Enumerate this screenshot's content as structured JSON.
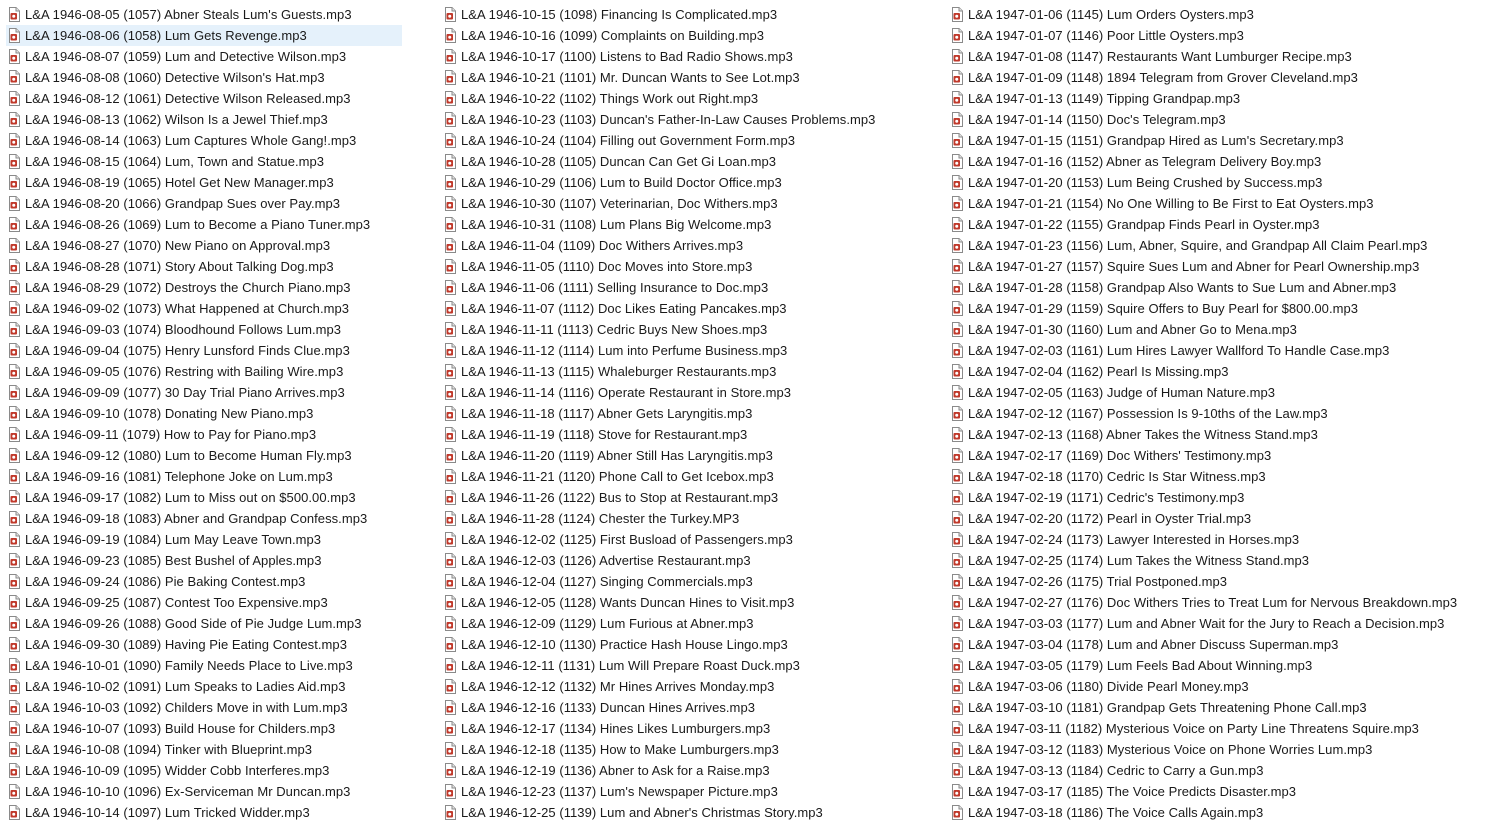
{
  "icon": "audio-file-icon",
  "selected_file": "L&A 1946-08-06 (1058) Lum Gets Revenge.mp3",
  "columns": [
    {
      "files": [
        "L&A 1946-08-05 (1057) Abner Steals Lum's Guests.mp3",
        "L&A 1946-08-06 (1058) Lum Gets Revenge.mp3",
        "L&A 1946-08-07 (1059) Lum and Detective Wilson.mp3",
        "L&A 1946-08-08 (1060) Detective Wilson's Hat.mp3",
        "L&A 1946-08-12 (1061) Detective Wilson Released.mp3",
        "L&A 1946-08-13 (1062) Wilson Is a Jewel Thief.mp3",
        "L&A 1946-08-14 (1063) Lum Captures Whole Gang!.mp3",
        "L&A 1946-08-15 (1064) Lum, Town and Statue.mp3",
        "L&A 1946-08-19 (1065) Hotel Get New Manager.mp3",
        "L&A 1946-08-20 (1066) Grandpap Sues over Pay.mp3",
        "L&A 1946-08-26 (1069) Lum to Become a Piano Tuner.mp3",
        "L&A 1946-08-27 (1070) New Piano on Approval.mp3",
        "L&A 1946-08-28 (1071) Story About Talking Dog.mp3",
        "L&A 1946-08-29 (1072) Destroys the Church Piano.mp3",
        "L&A 1946-09-02 (1073) What Happened at Church.mp3",
        "L&A 1946-09-03 (1074) Bloodhound Follows Lum.mp3",
        "L&A 1946-09-04 (1075) Henry Lunsford Finds Clue.mp3",
        "L&A 1946-09-05 (1076) Restring with Bailing Wire.mp3",
        "L&A 1946-09-09 (1077) 30 Day Trial Piano Arrives.mp3",
        "L&A 1946-09-10 (1078) Donating New Piano.mp3",
        "L&A 1946-09-11 (1079) How to Pay for Piano.mp3",
        "L&A 1946-09-12 (1080) Lum to Become Human Fly.mp3",
        "L&A 1946-09-16 (1081) Telephone Joke on Lum.mp3",
        "L&A 1946-09-17 (1082) Lum to Miss out on $500.00.mp3",
        "L&A 1946-09-18 (1083) Abner and Grandpap Confess.mp3",
        "L&A 1946-09-19 (1084) Lum May Leave Town.mp3",
        "L&A 1946-09-23 (1085) Best Bushel of Apples.mp3",
        "L&A 1946-09-24 (1086) Pie Baking Contest.mp3",
        "L&A 1946-09-25 (1087) Contest Too Expensive.mp3",
        "L&A 1946-09-26 (1088) Good Side of Pie Judge Lum.mp3",
        "L&A 1946-09-30 (1089) Having Pie Eating Contest.mp3",
        "L&A 1946-10-01 (1090) Family Needs Place to Live.mp3",
        "L&A 1946-10-02 (1091) Lum Speaks to Ladies Aid.mp3",
        "L&A 1946-10-03 (1092) Childers Move in with Lum.mp3",
        "L&A 1946-10-07 (1093) Build House for Childers.mp3",
        "L&A 1946-10-08 (1094) Tinker with Blueprint.mp3",
        "L&A 1946-10-09 (1095) Widder Cobb Interferes.mp3",
        "L&A 1946-10-10 (1096) Ex-Serviceman Mr Duncan.mp3",
        "L&A 1946-10-14 (1097) Lum Tricked Widder.mp3"
      ]
    },
    {
      "files": [
        "L&A 1946-10-15 (1098) Financing Is Complicated.mp3",
        "L&A 1946-10-16 (1099) Complaints on Building.mp3",
        "L&A 1946-10-17 (1100) Listens to Bad Radio Shows.mp3",
        "L&A 1946-10-21 (1101) Mr. Duncan Wants to See Lot.mp3",
        "L&A 1946-10-22 (1102) Things Work out Right.mp3",
        "L&A 1946-10-23 (1103) Duncan's Father-In-Law Causes Problems.mp3",
        "L&A 1946-10-24 (1104) Filling out Government Form.mp3",
        "L&A 1946-10-28 (1105) Duncan Can Get Gi Loan.mp3",
        "L&A 1946-10-29 (1106) Lum to Build Doctor Office.mp3",
        "L&A 1946-10-30 (1107) Veterinarian, Doc Withers.mp3",
        "L&A 1946-10-31 (1108) Lum Plans Big Welcome.mp3",
        "L&A 1946-11-04 (1109) Doc Withers Arrives.mp3",
        "L&A 1946-11-05 (1110) Doc Moves into Store.mp3",
        "L&A 1946-11-06 (1111) Selling Insurance to Doc.mp3",
        "L&A 1946-11-07 (1112) Doc Likes Eating Pancakes.mp3",
        "L&A 1946-11-11 (1113) Cedric Buys New Shoes.mp3",
        "L&A 1946-11-12 (1114) Lum into Perfume Business.mp3",
        "L&A 1946-11-13 (1115) Whaleburger Restaurants.mp3",
        "L&A 1946-11-14 (1116) Operate Restaurant in Store.mp3",
        "L&A 1946-11-18 (1117) Abner Gets Laryngitis.mp3",
        "L&A 1946-11-19 (1118) Stove for Restaurant.mp3",
        "L&A 1946-11-20 (1119) Abner Still Has Laryngitis.mp3",
        "L&A 1946-11-21 (1120) Phone Call to Get Icebox.mp3",
        "L&A 1946-11-26 (1122) Bus to Stop at Restaurant.mp3",
        "L&A 1946-11-28 (1124) Chester the Turkey.MP3",
        "L&A 1946-12-02 (1125) First Busload of Passengers.mp3",
        "L&A 1946-12-03 (1126) Advertise Restaurant.mp3",
        "L&A 1946-12-04 (1127) Singing Commercials.mp3",
        "L&A 1946-12-05 (1128) Wants Duncan Hines to Visit.mp3",
        "L&A 1946-12-09 (1129) Lum Furious at Abner.mp3",
        "L&A 1946-12-10 (1130) Practice Hash House Lingo.mp3",
        "L&A 1946-12-11 (1131) Lum Will Prepare Roast Duck.mp3",
        "L&A 1946-12-12 (1132) Mr Hines Arrives Monday.mp3",
        "L&A 1946-12-16 (1133) Duncan Hines Arrives.mp3",
        "L&A 1946-12-17 (1134) Hines Likes Lumburgers.mp3",
        "L&A 1946-12-18 (1135) How to Make Lumburgers.mp3",
        "L&A 1946-12-19 (1136) Abner to Ask for a Raise.mp3",
        "L&A 1946-12-23 (1137) Lum's Newspaper Picture.mp3",
        "L&A 1946-12-25 (1139) Lum and Abner's Christmas Story.mp3"
      ]
    },
    {
      "files": [
        "L&A 1947-01-06 (1145) Lum Orders Oysters.mp3",
        "L&A 1947-01-07 (1146) Poor Little Oysters.mp3",
        "L&A 1947-01-08 (1147) Restaurants Want Lumburger Recipe.mp3",
        "L&A 1947-01-09 (1148) 1894 Telegram from Grover Cleveland.mp3",
        "L&A 1947-01-13 (1149) Tipping Grandpap.mp3",
        "L&A 1947-01-14 (1150) Doc's Telegram.mp3",
        "L&A 1947-01-15 (1151) Grandpap Hired as Lum's Secretary.mp3",
        "L&A 1947-01-16 (1152) Abner as Telegram Delivery Boy.mp3",
        "L&A 1947-01-20 (1153) Lum Being Crushed by Success.mp3",
        "L&A 1947-01-21 (1154) No One Willing to Be First to Eat Oysters.mp3",
        "L&A 1947-01-22 (1155) Grandpap Finds Pearl in Oyster.mp3",
        "L&A 1947-01-23 (1156) Lum, Abner, Squire, and Grandpap All Claim Pearl.mp3",
        "L&A 1947-01-27 (1157) Squire Sues Lum and Abner for Pearl Ownership.mp3",
        "L&A 1947-01-28 (1158) Grandpap Also Wants to Sue Lum and Abner.mp3",
        "L&A 1947-01-29 (1159) Squire Offers to Buy Pearl for $800.00.mp3",
        "L&A 1947-01-30 (1160) Lum and Abner Go to Mena.mp3",
        "L&A 1947-02-03 (1161) Lum Hires Lawyer Wallford To Handle Case.mp3",
        "L&A 1947-02-04 (1162) Pearl Is Missing.mp3",
        "L&A 1947-02-05 (1163) Judge of Human Nature.mp3",
        "L&A 1947-02-12 (1167) Possession Is 9-10ths of the Law.mp3",
        "L&A 1947-02-13 (1168) Abner Takes the Witness Stand.mp3",
        "L&A 1947-02-17 (1169) Doc Withers' Testimony.mp3",
        "L&A 1947-02-18 (1170) Cedric Is Star Witness.mp3",
        "L&A 1947-02-19 (1171) Cedric's Testimony.mp3",
        "L&A 1947-02-20 (1172) Pearl in Oyster Trial.mp3",
        "L&A 1947-02-24 (1173) Lawyer Interested in Horses.mp3",
        "L&A 1947-02-25 (1174) Lum Takes the Witness Stand.mp3",
        "L&A 1947-02-26 (1175) Trial Postponed.mp3",
        "L&A 1947-02-27 (1176) Doc Withers Tries to Treat Lum for Nervous Breakdown.mp3",
        "L&A 1947-03-03 (1177) Lum and Abner Wait for the Jury to Reach a Decision.mp3",
        "L&A 1947-03-04 (1178) Lum and Abner Discuss Superman.mp3",
        "L&A 1947-03-05 (1179) Lum Feels Bad About Winning.mp3",
        "L&A 1947-03-06 (1180) Divide Pearl Money.mp3",
        "L&A 1947-03-10 (1181) Grandpap Gets Threatening Phone Call.mp3",
        "L&A 1947-03-11 (1182) Mysterious Voice on Party Line Threatens Squire.mp3",
        "L&A 1947-03-12 (1183) Mysterious Voice on Phone Worries Lum.mp3",
        "L&A 1947-03-13 (1184) Cedric to Carry a Gun.mp3",
        "L&A 1947-03-17 (1185) The Voice Predicts Disaster.mp3",
        "L&A 1947-03-18 (1186) The Voice Calls Again.mp3"
      ]
    }
  ]
}
